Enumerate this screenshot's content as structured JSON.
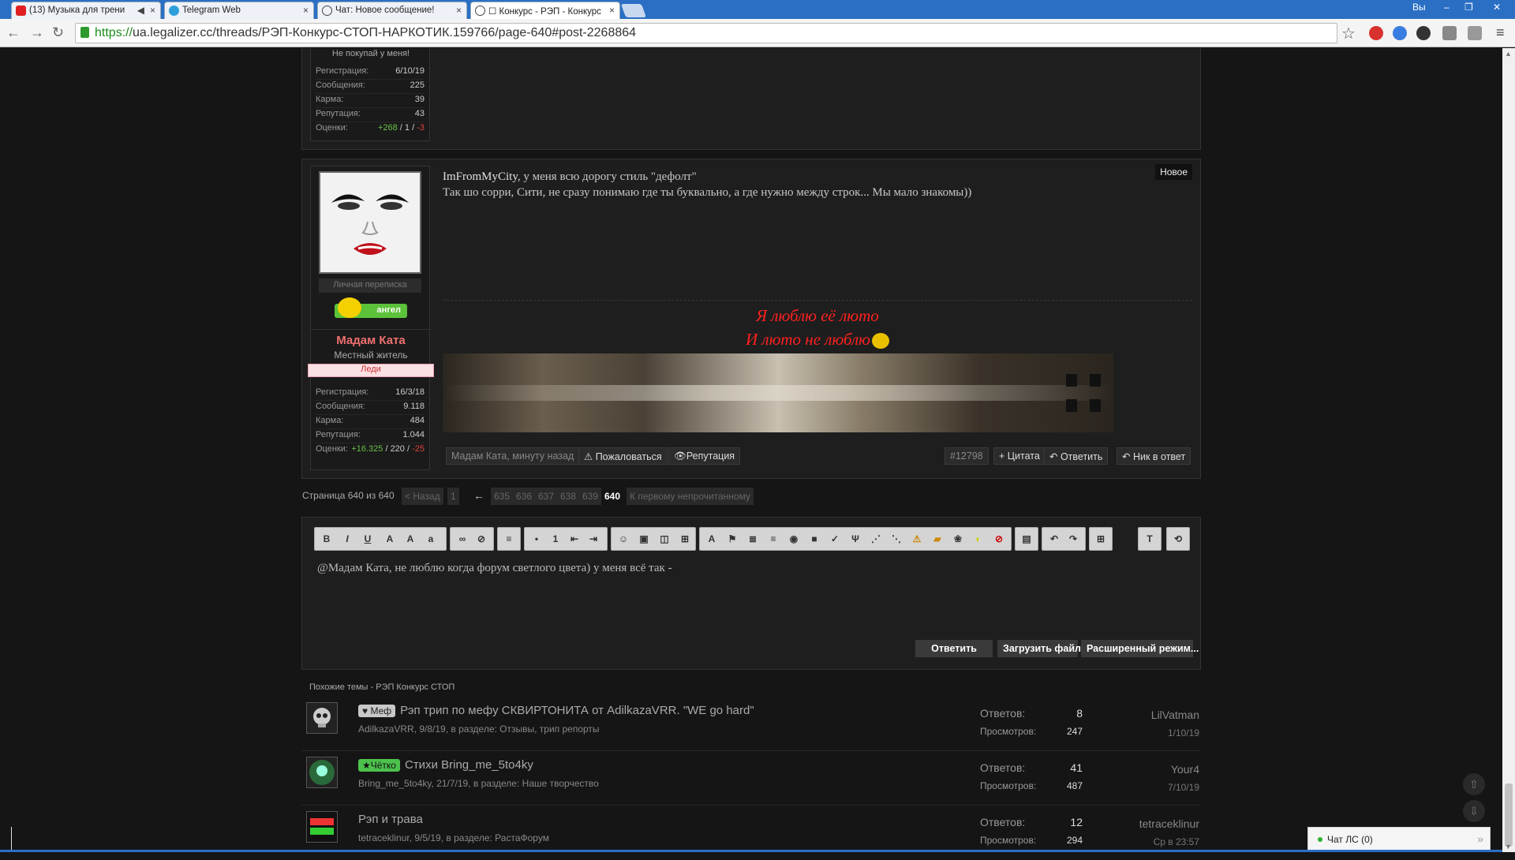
{
  "browser": {
    "tabs": [
      {
        "title": "(13) Музыка для трени",
        "icon_color": "#e02020"
      },
      {
        "title": "Telegram Web",
        "icon_color": "#2e9fd9"
      },
      {
        "title": "Чат: Новое сообщение!",
        "icon_color": "#444444"
      },
      {
        "title": "☐ Конкурс - РЭП - Конкурс",
        "icon_color": "#444444"
      }
    ],
    "profile_label": "Вы",
    "url_scheme": "https://",
    "url_rest": "ua.legalizer.cc/threads/РЭП-Конкурс-СТОП-НАРКОТИК.159766/page-640#post-2268864"
  },
  "prev_post": {
    "caption": "Не покупай у меня!",
    "stats": [
      {
        "label": "Регистрация:",
        "value": "6/10/19"
      },
      {
        "label": "Сообщения:",
        "value": "225"
      },
      {
        "label": "Карма:",
        "value": "39"
      },
      {
        "label": "Репутация:",
        "value": "43"
      }
    ],
    "ratings_label": "Оценки:",
    "ratings": {
      "pos": "+268",
      "mid": "1",
      "neg": "-3"
    }
  },
  "post": {
    "new_badge": "Новое",
    "private_msg": "Личная переписка",
    "angel_label": "ангел",
    "username": "Мадам Ката",
    "usertitle": "Местный житель",
    "userbanner": "Леди",
    "stats": [
      {
        "label": "Регистрация:",
        "value": "16/3/18"
      },
      {
        "label": "Сообщения:",
        "value": "9.118"
      },
      {
        "label": "Карма:",
        "value": "484"
      },
      {
        "label": "Репутация:",
        "value": "1.044"
      }
    ],
    "ratings_label": "Оценки:",
    "ratings": {
      "pos": "+16.325",
      "mid": "220",
      "neg": "-25"
    },
    "quote_user": "ImFromMyCity",
    "line1": ", у меня всю дорогу стиль \"дефолт\"",
    "line2": "Так шо сорри, Сити, не сразу понимаю где ты буквально, а где нужно между строк... Мы мало знакомы))",
    "sig_line1": "Я люблю её люто",
    "sig_line2": "И люто не люблю",
    "footer_time": "Мадам Ката, минуту назад",
    "report": "Пожаловаться",
    "reputation": "Репутация",
    "post_number": "#12798",
    "quote_btn": "+ Цитата",
    "reply_btn": "Ответить",
    "nick_btn": "Ник в ответ"
  },
  "pagination": {
    "label": "Страница 640 из 640",
    "prev": "< Назад",
    "first": "1",
    "arrow": "←",
    "pages": [
      "635",
      "636",
      "637",
      "638",
      "639"
    ],
    "current": "640",
    "unread": "К первому непрочитанному"
  },
  "editor": {
    "text": "@Мадам Ката, не люблю когда форум светлого цвета) у меня всё так -",
    "reply": "Ответить",
    "upload": "Загрузить файл",
    "advanced": "Расширенный режим..."
  },
  "similar": {
    "title": "Похожие темы - РЭП Конкурс СТОП",
    "replies_label": "Ответов:",
    "views_label": "Просмотров:",
    "threads": [
      {
        "prefix": "♥ Меф",
        "prefix_bg": "#c8c8c8",
        "prefix_color": "#222",
        "title": "Рэп трип по мефу СКВИРТОНИТА от AdilkazaVRR. \"WE go hard\"",
        "meta": "AdilkazaVRR, 9/8/19, в разделе: Отзывы, трип репорты",
        "replies": "8",
        "views": "247",
        "last_user": "LilVatman",
        "last_date": "1/10/19"
      },
      {
        "prefix": "★Чётко",
        "prefix_bg": "#4cc24c",
        "prefix_color": "#111",
        "title": "Стихи Bring_me_5to4ky",
        "meta": "Bring_me_5to4ky, 21/7/19, в разделе: Наше творчество",
        "replies": "41",
        "views": "487",
        "last_user": "Your4",
        "last_date": "7/10/19"
      },
      {
        "prefix": "",
        "prefix_bg": "",
        "prefix_color": "",
        "title": "Рэп и трава",
        "meta": "tetraceklinur, 9/5/19, в разделе: РастаФорум",
        "replies": "12",
        "views": "294",
        "last_user": "tetraceklinur",
        "last_date": "Ср в 23:57"
      }
    ]
  },
  "chat": {
    "label": "Чат ЛС (0)"
  }
}
